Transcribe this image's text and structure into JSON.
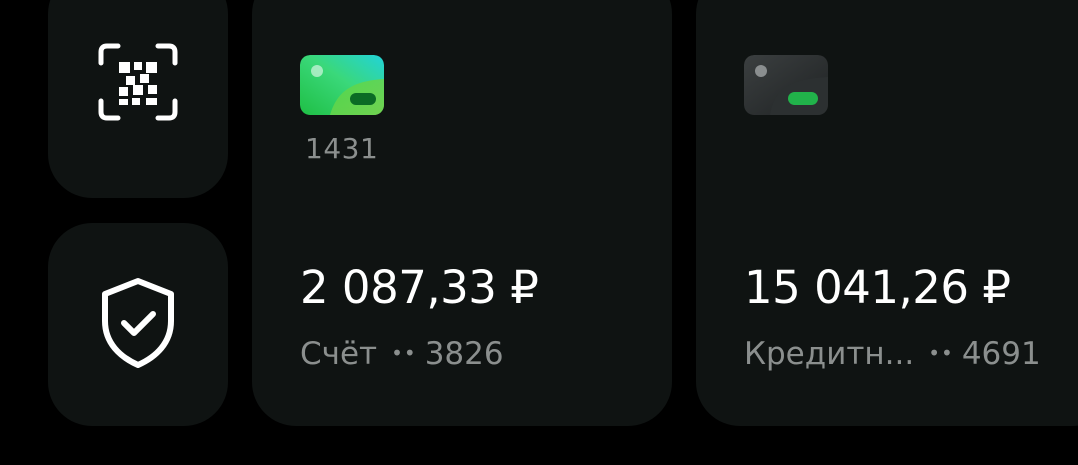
{
  "colors": {
    "background": "#000000",
    "tile": "#0f1312",
    "primary_text": "#ffffff",
    "secondary_text": "#8b8f8e",
    "accent_green": "#21a038"
  },
  "tiles": {
    "qr": {
      "icon": "qr-scan-icon"
    },
    "security": {
      "icon": "shield-check-icon"
    }
  },
  "cards": [
    {
      "icon": "green-card-icon",
      "last4": "1431",
      "amount": "2 087,33 ₽",
      "account_name": "Счёт",
      "dots": "••",
      "account_number": "3826"
    },
    {
      "icon": "dark-card-icon",
      "last4": "",
      "amount": "15 041,26 ₽",
      "account_name": "Кредитн...",
      "dots": "••",
      "account_number": "4691"
    }
  ]
}
